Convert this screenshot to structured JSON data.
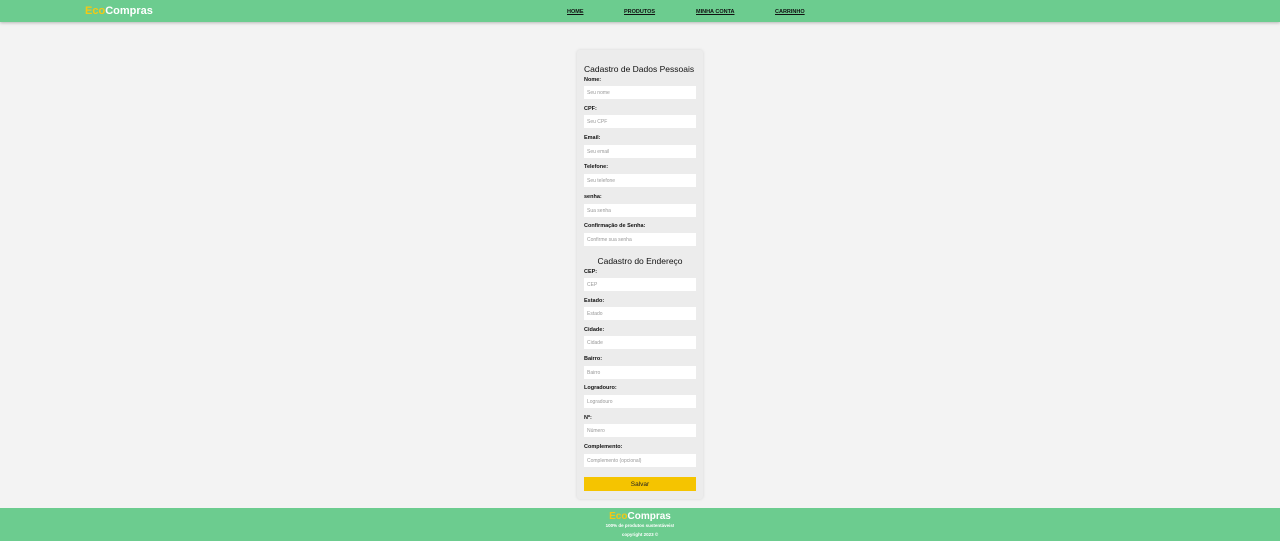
{
  "header": {
    "logo_eco": "Eco",
    "logo_rest": "Compras",
    "nav": [
      "HOME",
      "PRODUTOS",
      "MINHA CONTA",
      "CARRINHO"
    ]
  },
  "form": {
    "personal_title": "Cadastro de Dados Pessoais",
    "personal_fields": [
      {
        "label": "Nome:",
        "placeholder": "Seu nome"
      },
      {
        "label": "CPF:",
        "placeholder": "Seu CPF"
      },
      {
        "label": "Email:",
        "placeholder": "Seu email"
      },
      {
        "label": "Telefone:",
        "placeholder": "Seu telefone"
      },
      {
        "label": "senha:",
        "placeholder": "Sua senha"
      },
      {
        "label": "Confirmação de Senha:",
        "placeholder": "Confirme sua senha"
      }
    ],
    "address_title": "Cadastro do Endereço",
    "address_fields": [
      {
        "label": "CEP:",
        "placeholder": "CEP"
      },
      {
        "label": "Estado:",
        "placeholder": "Estado"
      },
      {
        "label": "Cidade:",
        "placeholder": "Cidade"
      },
      {
        "label": "Bairro:",
        "placeholder": "Bairro"
      },
      {
        "label": "Logradouro:",
        "placeholder": "Logradouro"
      },
      {
        "label": "Nº:",
        "placeholder": "Número"
      },
      {
        "label": "Complemento:",
        "placeholder": "Complemento (opcional)"
      }
    ],
    "save_label": "Salvar"
  },
  "footer": {
    "logo_eco": "Eco",
    "logo_rest": "Compras",
    "tagline": "100% de produtos sustentáveis!",
    "copyright": "copyright 2023 ©"
  },
  "colors": {
    "header_bg": "#6ccc8f",
    "logo_accent": "#f5c814",
    "button_bg": "#f5c400",
    "page_bg": "#f3f3f3"
  }
}
